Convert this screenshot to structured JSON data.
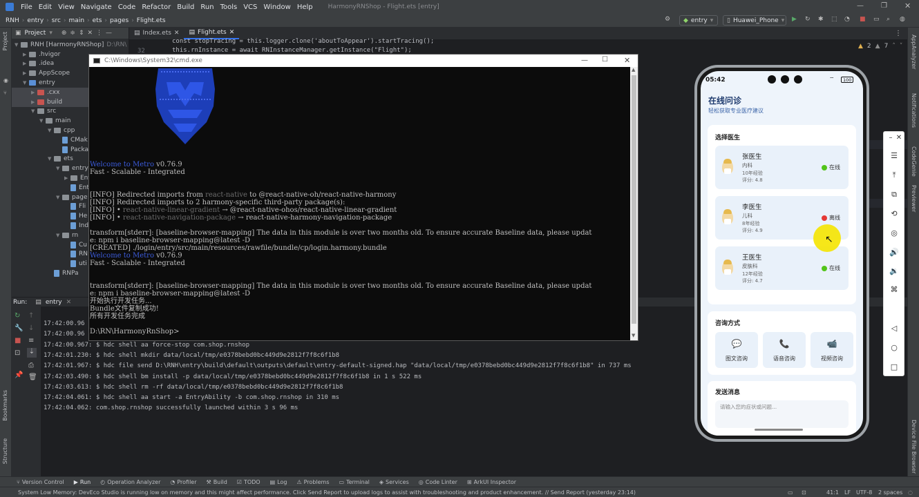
{
  "title_bar": {
    "menus": [
      "File",
      "Edit",
      "View",
      "Navigate",
      "Code",
      "Refactor",
      "Build",
      "Run",
      "Tools",
      "VCS",
      "Window",
      "Help"
    ],
    "window_title": "HarmonyRNShop - Flight.ets [entry]"
  },
  "nav_bar": {
    "breadcrumbs": [
      "RNH",
      "entry",
      "src",
      "main",
      "ets",
      "pages",
      "Flight.ets"
    ],
    "module_select": "entry",
    "device_select": "Huawei_Phone"
  },
  "project_panel": {
    "header": "Project",
    "items": [
      {
        "label": "RNH [HarmonyRNShop]",
        "extra": "D:\\RN\\"
      },
      {
        "label": ".hvigor"
      },
      {
        "label": ".idea"
      },
      {
        "label": "AppScope"
      },
      {
        "label": "entry"
      },
      {
        "label": ".cxx"
      },
      {
        "label": "build"
      },
      {
        "label": "src"
      },
      {
        "label": "main"
      },
      {
        "label": "cpp"
      },
      {
        "label": "CMak"
      },
      {
        "label": "Packa"
      },
      {
        "label": "ets"
      },
      {
        "label": "entry"
      },
      {
        "label": "Entry"
      },
      {
        "label": "Entr"
      },
      {
        "label": "page"
      },
      {
        "label": "Fli"
      },
      {
        "label": "He"
      },
      {
        "label": "Ind"
      },
      {
        "label": "rn"
      },
      {
        "label": "Cu"
      },
      {
        "label": "RN"
      },
      {
        "label": "uti"
      },
      {
        "label": "RNPa"
      }
    ]
  },
  "editor": {
    "tabs": [
      {
        "label": "Index.ets",
        "active": false
      },
      {
        "label": "Flight.ets",
        "active": true
      }
    ],
    "line_number": "32",
    "line1": "const stopTracing = this.logger.clone('aboutToAppear').startTracing();",
    "line2": "this.rnInstance = await RNInstanceManager.getInstance(\"Flight\");",
    "inspection_warn": "2",
    "inspection_weak": "7"
  },
  "cmd": {
    "title": "C:\\Windows\\System32\\cmd.exe",
    "lines": [
      {
        "parts": [
          {
            "t": "              ",
            "c": ""
          },
          {
            "t": "Welcome to Metro",
            "c": "blue"
          },
          {
            "t": " v0.76.9",
            "c": ""
          }
        ]
      },
      {
        "parts": [
          {
            "t": "            Fast - Scalable - Integrated",
            "c": ""
          }
        ]
      },
      {
        "parts": [
          {
            "t": "",
            "c": ""
          }
        ]
      },
      {
        "parts": [
          {
            "t": "",
            "c": ""
          }
        ]
      },
      {
        "parts": [
          {
            "t": "[INFO] Redirected imports from ",
            "c": ""
          },
          {
            "t": "react-native",
            "c": "dim"
          },
          {
            "t": " to @react-native-oh/react-native-harmony",
            "c": ""
          }
        ]
      },
      {
        "parts": [
          {
            "t": "[INFO] Redirected imports to 2 harmony-specific third-party package(s):",
            "c": ""
          }
        ]
      },
      {
        "parts": [
          {
            "t": "[INFO] • ",
            "c": ""
          },
          {
            "t": "react-native-linear-gradient",
            "c": "dim"
          },
          {
            "t": " → @react-native-ohos/react-native-linear-gradient",
            "c": ""
          }
        ]
      },
      {
        "parts": [
          {
            "t": "[INFO] • ",
            "c": ""
          },
          {
            "t": "react-native-navigation-package",
            "c": "dim"
          },
          {
            "t": " → react-native-harmony-navigation-package",
            "c": ""
          }
        ]
      },
      {
        "parts": [
          {
            "t": "",
            "c": ""
          }
        ]
      },
      {
        "parts": [
          {
            "t": "transform[stderr]: [baseline-browser-mapping] The data in this module is over two months old.  To ensure accurate Baseline data, please updat",
            "c": ""
          }
        ]
      },
      {
        "parts": [
          {
            "t": "e:  npm i baseline-browser-mapping@latest -D",
            "c": ""
          }
        ]
      },
      {
        "parts": [
          {
            "t": "[CREATED] ./login/entry/src/main/resources/rawfile/bundle/cp/login.harmony.bundle",
            "c": ""
          }
        ]
      },
      {
        "parts": [
          {
            "t": "              ",
            "c": ""
          },
          {
            "t": "Welcome to Metro",
            "c": "blue"
          },
          {
            "t": " v0.76.9",
            "c": ""
          }
        ]
      },
      {
        "parts": [
          {
            "t": "            Fast - Scalable - Integrated",
            "c": ""
          }
        ]
      },
      {
        "parts": [
          {
            "t": "",
            "c": ""
          }
        ]
      },
      {
        "parts": [
          {
            "t": "",
            "c": ""
          }
        ]
      },
      {
        "parts": [
          {
            "t": "transform[stderr]: [baseline-browser-mapping] The data in this module is over two months old.  To ensure accurate Baseline data, please updat",
            "c": ""
          }
        ]
      },
      {
        "parts": [
          {
            "t": "e:  npm i baseline-browser-mapping@latest -D",
            "c": ""
          }
        ]
      },
      {
        "parts": [
          {
            "t": "开始执行开发任务...",
            "c": ""
          }
        ]
      },
      {
        "parts": [
          {
            "t": "Bundle文件复制成功!",
            "c": ""
          }
        ]
      },
      {
        "parts": [
          {
            "t": "所有开发任务完成",
            "c": ""
          }
        ]
      },
      {
        "parts": [
          {
            "t": "",
            "c": ""
          }
        ]
      },
      {
        "parts": [
          {
            "t": "D:\\RN\\HarmonyRnShop>",
            "c": ""
          }
        ]
      }
    ]
  },
  "run_panel": {
    "label": "Run:",
    "config": "entry",
    "logs": [
      "17:42:00.96",
      "17:42:00.96",
      "17:42:00.967: $ hdc shell aa force-stop com.shop.rnshop",
      "17:42:01.230: $ hdc shell mkdir data/local/tmp/e0378bebd0bc449d9e2812f7f8c6f1b8",
      "17:42:01.967: $ hdc file send D:\\RNH\\entry\\build\\default\\outputs\\default\\entry-default-signed.hap \"data/local/tmp/e0378bebd0bc449d9e2812f7f8c6f1b8\" in 737 ms",
      "17:42:03.490: $ hdc shell bm install -p data/local/tmp/e0378bebd0bc449d9e2812f7f8c6f1b8  in 1 s 522 ms",
      "17:42:03.613: $ hdc shell rm -rf data/local/tmp/e0378bebd0bc449d9e2812f7f8c6f1b8",
      "17:42:04.061: $ hdc shell aa start -a EntryAbility -b com.shop.rnshop in 310 ms",
      "17:42:04.062: com.shop.rnshop successfully launched within 3 s 96 ms"
    ]
  },
  "left_stripe": {
    "project": "Project",
    "bookmarks": "Bookmarks",
    "structure": "Structure"
  },
  "right_stripe": {
    "appanalyzer": "AppAnalyzer",
    "notifications": "Notifications",
    "codegenie": "CodeGenie",
    "previewer": "Previewer",
    "device_file_browser": "Device File Browser"
  },
  "tool_windows": [
    "Version Control",
    "Run",
    "Operation Analyzer",
    "Profiler",
    "Build",
    "TODO",
    "Log",
    "Problems",
    "Terminal",
    "Services",
    "Code Linter",
    "ArkUI Inspector"
  ],
  "status_bar": {
    "message": "System Low Memory: DevEco Studio is running low on memory and this might affect performance. Click Send Report to upload logs to assist with troubleshooting and product enhancement. // Send Report (yesterday 23:14)",
    "position": "41:1",
    "line_sep": "LF",
    "encoding": "UTF-8",
    "indent": "2 spaces"
  },
  "phone": {
    "time": "05:42",
    "battery": "100",
    "app_title": "在线问诊",
    "app_subtitle": "轻松获取专业医疗建议",
    "select_doctor": "选择医生",
    "doctors": [
      {
        "name": "张医生",
        "dept": "内科",
        "exp": "10年经验",
        "rating": "评分: 4.8",
        "status": "在线",
        "status_color": "#52c41a"
      },
      {
        "name": "李医生",
        "dept": "儿科",
        "exp": "8年经验",
        "rating": "评分: 4.9",
        "status": "离线",
        "status_color": "#e53935"
      },
      {
        "name": "王医生",
        "dept": "皮肤科",
        "exp": "12年经验",
        "rating": "评分: 4.7",
        "status": "在线",
        "status_color": "#52c41a"
      }
    ],
    "consult_title": "咨询方式",
    "consult_options": [
      {
        "label": "图文咨询",
        "icon": "chat-icon"
      },
      {
        "label": "语音咨询",
        "icon": "phone-icon"
      },
      {
        "label": "视频咨询",
        "icon": "video-icon"
      }
    ],
    "send_title": "发送消息",
    "message_placeholder": "请输入您的症状或问题..."
  },
  "colors": {
    "accent": "#3574f0",
    "ide_bg": "#2b2d30",
    "editor_bg": "#1e1f22",
    "phone_bg": "#eef4fb",
    "cursor_highlight": "#f5e400"
  }
}
